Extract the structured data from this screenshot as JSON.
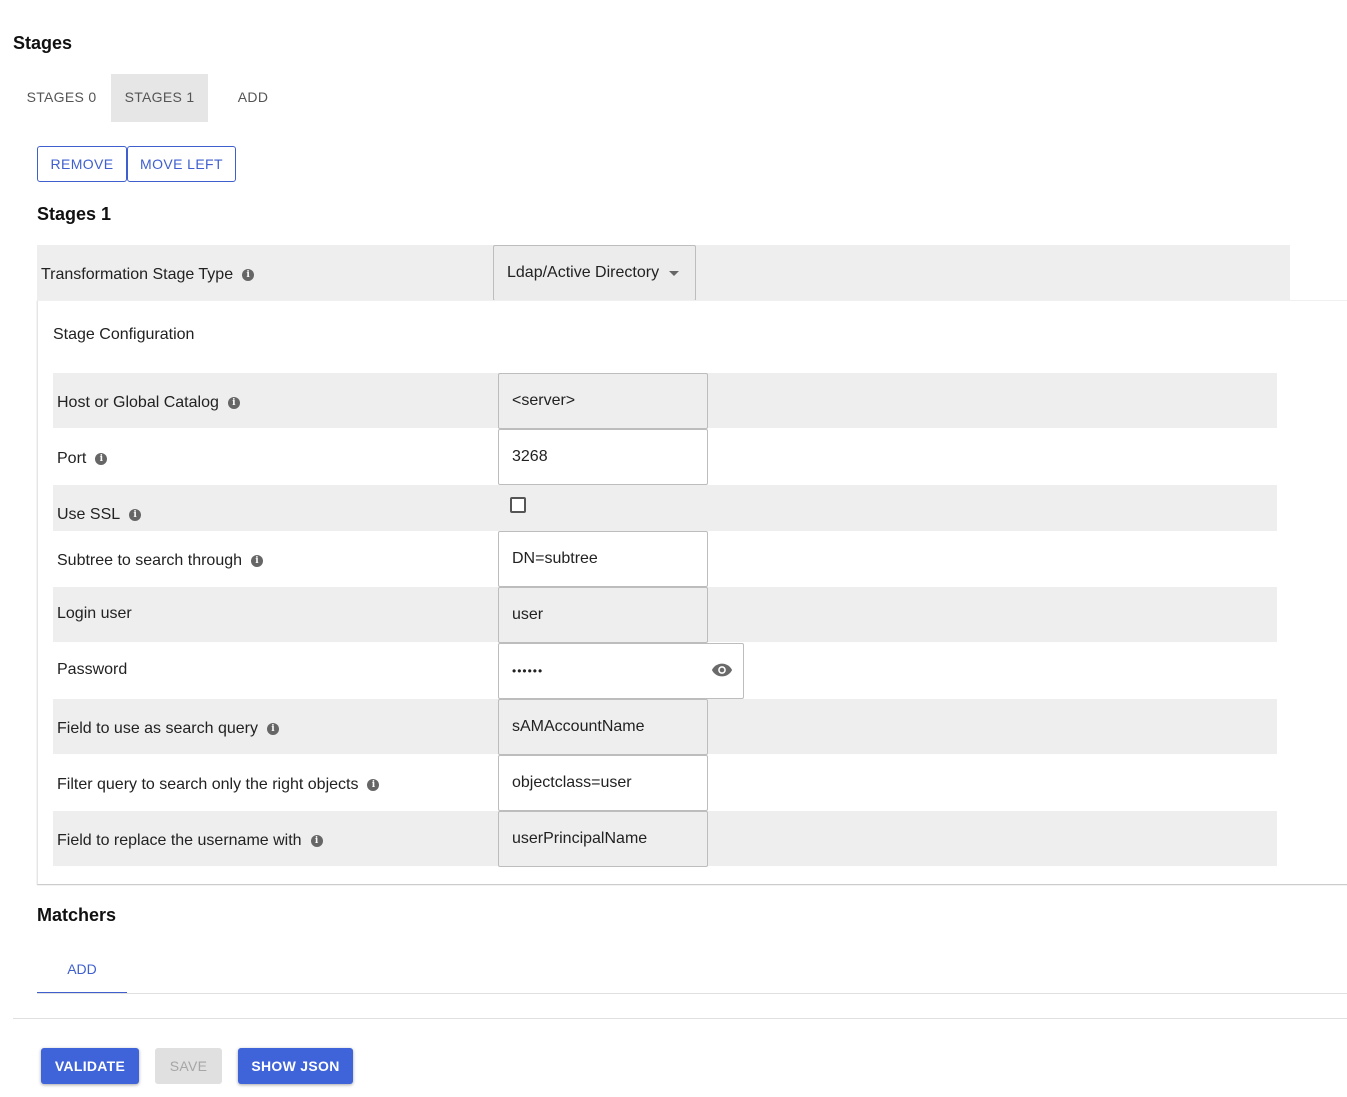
{
  "page": {
    "title": "Stages",
    "tabs": [
      {
        "label": "STAGES 0",
        "selected": false
      },
      {
        "label": "STAGES 1",
        "selected": true
      },
      {
        "label": "ADD",
        "selected": false
      }
    ],
    "actions": {
      "remove": "REMOVE",
      "move_left": "MOVE LEFT"
    },
    "stage_heading": "Stages 1",
    "stage_type": {
      "label": "Transformation Stage Type",
      "value": "Ldap/Active Directory"
    },
    "config": {
      "title": "Stage Configuration",
      "fields": {
        "host": {
          "label": "Host or Global Catalog",
          "value": "<server>"
        },
        "port": {
          "label": "Port",
          "value": "3268"
        },
        "ssl": {
          "label": "Use SSL",
          "checked": false
        },
        "subtree": {
          "label": "Subtree to search through",
          "value": "DN=subtree"
        },
        "login": {
          "label": "Login user",
          "value": "user"
        },
        "password": {
          "label": "Password",
          "value": "••••••"
        },
        "search_field": {
          "label": "Field to use as search query",
          "value": "sAMAccountName"
        },
        "filter": {
          "label": "Filter query to search only the right objects",
          "value": "objectclass=user"
        },
        "replace": {
          "label": "Field to replace the username with",
          "value": "userPrincipalName"
        }
      }
    },
    "matchers": {
      "title": "Matchers",
      "add_label": "ADD"
    },
    "footer": {
      "validate": "VALIDATE",
      "save": "SAVE",
      "show_json": "SHOW JSON"
    },
    "icons": {
      "info": "info-icon",
      "dropdown": "chevron-down-icon",
      "reveal": "eye-icon"
    },
    "colors": {
      "accent": "#3f63d8",
      "row_gray": "#eeeeee"
    }
  }
}
